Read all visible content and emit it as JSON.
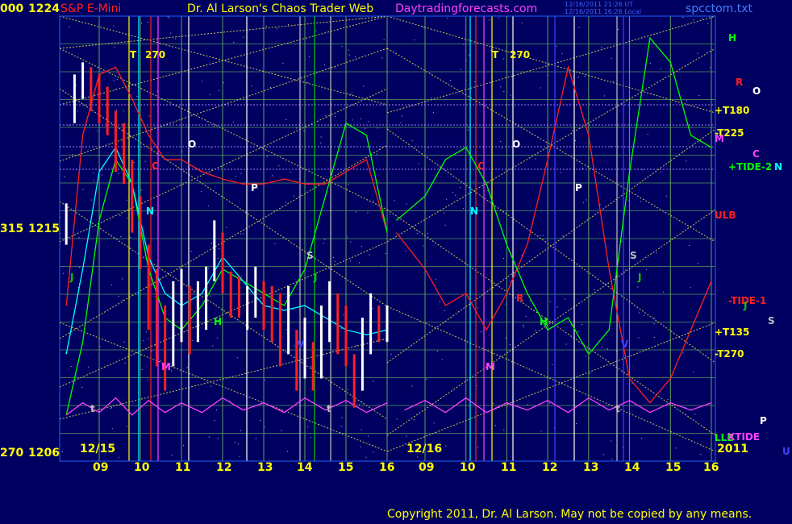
{
  "header": {
    "left_code": "000",
    "symbol": "S&P E-Mini",
    "title": "Dr. Al Larson's Chaos Trader Web",
    "site": "Daytradingforecasts.com",
    "timestamp_ut": "12/16/2011 21:26 UT",
    "timestamp_local": "12/16/2011 16:26 Local",
    "file": "spcctom.txt",
    "year": "2011",
    "copyright": "Copyright 2011, Dr. Al Larson. May not be copied by any means."
  },
  "y_axis": [
    {
      "code": "000",
      "value": 1224
    },
    {
      "code": "315",
      "value": 1215
    },
    {
      "code": "270",
      "value": 1206
    }
  ],
  "x_axis": {
    "dates": [
      "12/15",
      "12/16"
    ],
    "hours": [
      "09",
      "10",
      "11",
      "12",
      "13",
      "14",
      "15",
      "16",
      "09",
      "10",
      "11",
      "12",
      "13",
      "14",
      "15",
      "16"
    ]
  },
  "right_labels": [
    {
      "text": "H",
      "color": "#00ff00"
    },
    {
      "text": "R",
      "color": "#ff2020"
    },
    {
      "text": "O",
      "color": "#ffffff"
    },
    {
      "text": "+T180",
      "color": "#ffff00"
    },
    {
      "text": "-T225",
      "color": "#ffff00"
    },
    {
      "text": "M",
      "color": "#ff40ff"
    },
    {
      "text": "C",
      "color": "#ff40ff"
    },
    {
      "text": "+TIDE-2",
      "color": "#00ff00"
    },
    {
      "text": "N",
      "color": "#00ffff"
    },
    {
      "text": "ULB",
      "color": "#ff2020"
    },
    {
      "text": "-TIDE-1",
      "color": "#ff2020"
    },
    {
      "text": "J",
      "color": "#00cc00"
    },
    {
      "text": "S",
      "color": "#c0c0c0"
    },
    {
      "text": "+T135",
      "color": "#ffff00"
    },
    {
      "text": "-T270",
      "color": "#ffff00"
    },
    {
      "text": "P",
      "color": "#ffffff"
    },
    {
      "text": "LLB",
      "color": "#00ff00"
    },
    {
      "text": "XTIDE",
      "color": "#ff40ff"
    },
    {
      "text": "U",
      "color": "#4040ff"
    }
  ],
  "chart_labels": [
    {
      "text": "T",
      "color": "#ffff00"
    },
    {
      "text": "270",
      "color": "#ffff00"
    },
    {
      "text": "T",
      "color": "#ffff00"
    },
    {
      "text": "270",
      "color": "#ffff00"
    },
    {
      "text": "O",
      "color": "#ffffff"
    },
    {
      "text": "O",
      "color": "#ffffff"
    },
    {
      "text": "C",
      "color": "#ff2020"
    },
    {
      "text": "C",
      "color": "#ff2020"
    },
    {
      "text": "N",
      "color": "#00ffff"
    },
    {
      "text": "N",
      "color": "#00ffff"
    },
    {
      "text": "P",
      "color": "#ffffff"
    },
    {
      "text": "P",
      "color": "#ffffff"
    },
    {
      "text": "S",
      "color": "#c0c0c0"
    },
    {
      "text": "S",
      "color": "#c0c0c0"
    },
    {
      "text": "J",
      "color": "#00cc00"
    },
    {
      "text": "J",
      "color": "#00cc00"
    },
    {
      "text": "J",
      "color": "#00cc00"
    },
    {
      "text": "H",
      "color": "#00ff00"
    },
    {
      "text": "H",
      "color": "#00ff00"
    },
    {
      "text": "R",
      "color": "#ff2020"
    },
    {
      "text": "M",
      "color": "#ff40ff"
    },
    {
      "text": "M",
      "color": "#ff40ff"
    },
    {
      "text": "V",
      "color": "#4040ff"
    },
    {
      "text": "V",
      "color": "#4040ff"
    },
    {
      "text": "t",
      "color": "#c0c0c0"
    },
    {
      "text": "t",
      "color": "#c0c0c0"
    },
    {
      "text": "t",
      "color": "#c0c0c0"
    }
  ],
  "chart_data": {
    "type": "line",
    "ylim": [
      1206,
      1224
    ],
    "days": [
      "12/15",
      "12/16"
    ],
    "price_bars": {
      "x_hours": [
        8.2,
        8.4,
        8.6,
        8.8,
        9.0,
        9.2,
        9.4,
        9.6,
        9.8,
        10.0,
        10.2,
        10.4,
        10.6,
        10.8,
        11.0,
        11.2,
        11.4,
        11.6,
        11.8,
        12.0,
        12.2,
        12.4,
        12.6,
        12.8,
        13.0,
        13.2,
        13.4,
        13.6,
        13.8,
        14.0,
        14.2,
        14.4,
        14.6,
        14.8,
        15.0,
        15.2,
        15.4,
        15.6,
        15.8,
        16.0
      ],
      "high": [
        1216.2,
        1221.5,
        1222.0,
        1221.8,
        1221.5,
        1221.0,
        1220.0,
        1219.5,
        1218.0,
        1216.5,
        1214.5,
        1213.5,
        1212.0,
        1213.0,
        1213.5,
        1212.8,
        1213.0,
        1213.6,
        1215.5,
        1215.0,
        1213.4,
        1213.2,
        1212.8,
        1213.6,
        1213.0,
        1212.8,
        1212.5,
        1212.8,
        1211.0,
        1211.5,
        1210.5,
        1212.0,
        1213.0,
        1212.5,
        1212.0,
        1210.0,
        1211.5,
        1212.5,
        1212.0,
        1212.0
      ],
      "low": [
        1214.5,
        1219.5,
        1220.5,
        1220.0,
        1219.5,
        1219.0,
        1217.5,
        1217.0,
        1215.0,
        1213.5,
        1211.0,
        1209.5,
        1208.5,
        1209.5,
        1210.5,
        1210.0,
        1210.5,
        1211.0,
        1213.0,
        1212.5,
        1211.5,
        1211.5,
        1211.0,
        1211.5,
        1211.0,
        1210.5,
        1209.5,
        1210.0,
        1208.5,
        1209.0,
        1208.5,
        1209.0,
        1210.5,
        1210.0,
        1209.5,
        1207.8,
        1208.5,
        1210.0,
        1210.5,
        1210.5
      ],
      "close": [
        1215.5,
        1221.0,
        1221.5,
        1221.0,
        1220.5,
        1220.0,
        1218.5,
        1218.0,
        1216.0,
        1214.0,
        1212.0,
        1210.5,
        1209.5,
        1211.0,
        1212.0,
        1211.5,
        1212.0,
        1213.0,
        1214.5,
        1213.5,
        1212.5,
        1212.0,
        1212.0,
        1212.5,
        1212.0,
        1211.5,
        1210.5,
        1211.5,
        1209.5,
        1210.5,
        1209.0,
        1210.5,
        1212.0,
        1211.0,
        1210.5,
        1209.0,
        1210.0,
        1211.5,
        1211.0,
        1211.5
      ]
    },
    "series": [
      {
        "color": "#ff2020",
        "x_hours": [
          8.2,
          8.6,
          9.0,
          9.4,
          9.8,
          10.2,
          10.6,
          11.0,
          11.5,
          12.0,
          12.5,
          13.0,
          13.5,
          14.0,
          14.5,
          15.0,
          15.5,
          16.0,
          8.3,
          9.0,
          9.5,
          10.0,
          10.5,
          11.0,
          11.5,
          12.0,
          12.5,
          13.0,
          13.5,
          14.0,
          14.5,
          15.0,
          15.5,
          16.0
        ],
        "y": [
          1212.0,
          1219.0,
          1221.5,
          1221.8,
          1220.5,
          1219.0,
          1218.0,
          1218.0,
          1217.5,
          1217.2,
          1217.0,
          1217.0,
          1217.2,
          1217.0,
          1217.0,
          1217.5,
          1218.0,
          1215.0,
          1215.0,
          1213.5,
          1212.0,
          1212.5,
          1211.0,
          1212.5,
          1214.5,
          1218.0,
          1221.8,
          1219.0,
          1213.5,
          1209.0,
          1208.0,
          1209.0,
          1211.0,
          1213.0
        ]
      },
      {
        "color": "#00ff00",
        "x_hours": [
          8.2,
          8.6,
          9.0,
          9.4,
          9.8,
          10.2,
          10.6,
          11.0,
          11.5,
          12.0,
          12.5,
          13.0,
          13.5,
          14.0,
          14.5,
          15.0,
          15.5,
          16.0,
          8.3,
          9.0,
          9.5,
          10.0,
          10.5,
          11.0,
          11.5,
          12.0,
          12.5,
          13.0,
          13.5,
          14.0,
          14.5,
          15.0,
          15.5,
          16.0
        ],
        "y": [
          1207.5,
          1210.5,
          1215.5,
          1218.0,
          1217.0,
          1213.5,
          1211.5,
          1211.0,
          1212.0,
          1213.5,
          1213.0,
          1212.5,
          1212.0,
          1213.5,
          1216.5,
          1219.5,
          1219.0,
          1215.0,
          1215.5,
          1216.5,
          1218.0,
          1218.5,
          1217.0,
          1214.5,
          1212.5,
          1211.0,
          1211.5,
          1210.0,
          1211.0,
          1217.5,
          1223.0,
          1222.0,
          1219.0,
          1218.5
        ]
      },
      {
        "color": "#00ffff",
        "x_hours": [
          8.2,
          8.6,
          9.0,
          9.4,
          9.8,
          10.2,
          10.6,
          11.0,
          11.5,
          12.0,
          12.5,
          13.0,
          13.5,
          14.0,
          14.5,
          15.0,
          15.5,
          16.0
        ],
        "y": [
          1210.0,
          1213.5,
          1217.5,
          1218.5,
          1217.0,
          1214.0,
          1212.5,
          1212.0,
          1212.5,
          1214.0,
          1213.0,
          1212.0,
          1211.8,
          1212.0,
          1211.5,
          1211.0,
          1210.8,
          1211.0
        ]
      },
      {
        "color": "#ff40ff",
        "x_hours": [
          8.2,
          8.6,
          9.0,
          9.4,
          9.8,
          10.2,
          10.6,
          11.0,
          11.5,
          12.0,
          12.5,
          13.0,
          13.5,
          14.0,
          14.5,
          15.0,
          15.5,
          16.0,
          8.5,
          9.0,
          9.5,
          10.0,
          10.5,
          11.0,
          11.5,
          12.0,
          12.5,
          13.0,
          13.5,
          14.0,
          14.5,
          15.0,
          15.5,
          16.0
        ],
        "y": [
          1207.5,
          1208.0,
          1207.6,
          1208.2,
          1207.5,
          1208.1,
          1207.6,
          1208.0,
          1207.6,
          1208.2,
          1207.7,
          1208.0,
          1207.6,
          1208.2,
          1207.7,
          1208.1,
          1207.6,
          1208.0,
          1207.7,
          1208.1,
          1207.6,
          1208.2,
          1207.6,
          1208.0,
          1207.7,
          1208.1,
          1207.6,
          1208.2,
          1207.7,
          1208.1,
          1207.6,
          1208.0,
          1207.7,
          1208.0
        ]
      }
    ]
  }
}
